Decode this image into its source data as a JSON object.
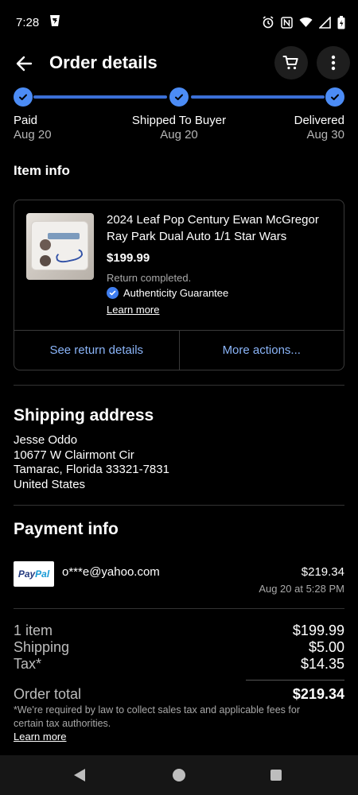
{
  "status_bar": {
    "time": "7:28",
    "icons": [
      "app-notification-icon",
      "alarm-icon",
      "nfc-icon",
      "wifi-icon",
      "signal-icon",
      "battery-icon"
    ]
  },
  "header": {
    "title": "Order details",
    "back_icon": "arrow-left-icon",
    "cart_icon": "cart-icon",
    "more_icon": "more-vertical-icon"
  },
  "progress": {
    "steps": [
      {
        "label": "Paid",
        "date": "Aug 20"
      },
      {
        "label": "Shipped To Buyer",
        "date": "Aug 20"
      },
      {
        "label": "Delivered",
        "date": "Aug 30"
      }
    ]
  },
  "item_info": {
    "heading": "Item info",
    "title": "2024 Leaf Pop Century Ewan McGregor Ray Park Dual Auto 1/1  Star Wars",
    "price": "$199.99",
    "status": "Return completed.",
    "authenticity": "Authenticity Guarantee",
    "learn_more": "Learn more",
    "actions": {
      "return_details": "See return details",
      "more_actions": "More actions..."
    }
  },
  "shipping": {
    "heading": "Shipping address",
    "name": "Jesse Oddo",
    "street": "10677 W Clairmont Cir",
    "city": "Tamarac, Florida 33321-7831",
    "country": "United States"
  },
  "payment": {
    "heading": "Payment info",
    "method_logo": "PayPal",
    "email": "o***e@yahoo.com",
    "amount": "$219.34",
    "date": "Aug 20 at 5:28 PM"
  },
  "summary": {
    "rows": [
      {
        "label": "1 item",
        "value": "$199.99"
      },
      {
        "label": "Shipping",
        "value": "$5.00"
      },
      {
        "label": "Tax*",
        "value": "$14.35"
      }
    ],
    "total_label": "Order total",
    "total_value": "$219.34",
    "tax_note": "*We're required by law to collect sales tax and applicable fees for certain tax authorities.",
    "learn_more": "Learn more"
  },
  "colors": {
    "accent": "#4c8cf5",
    "link": "#8ab4f8",
    "background": "#000000"
  }
}
